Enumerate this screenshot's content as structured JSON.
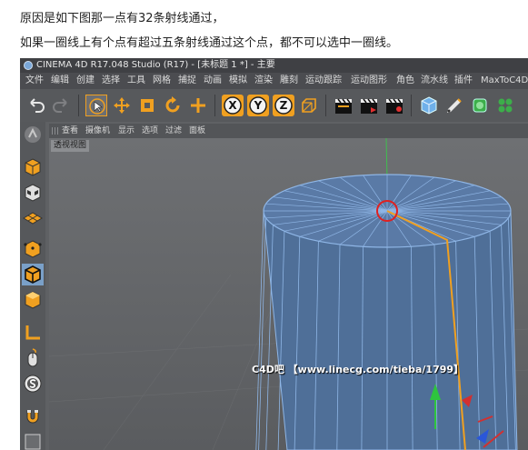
{
  "captions": {
    "line1": "原因是如下图那一点有32条射线通过，",
    "line2": "如果一圈线上有个点有超过五条射线通过这个点，都不可以选中一圈线。"
  },
  "window": {
    "title": "CINEMA 4D R17.048 Studio (R17) - [未标题 1 *] - 主要"
  },
  "menubar": {
    "items": [
      "文件",
      "编辑",
      "创建",
      "选择",
      "工具",
      "网格",
      "捕捉",
      "动画",
      "模拟",
      "渲染",
      "雕刻",
      "运动跟踪",
      "运动图形",
      "角色",
      "流水线",
      "插件",
      "MaxToC4D"
    ]
  },
  "toolbar": {
    "axis_x": "X",
    "axis_y": "Y",
    "axis_z": "Z"
  },
  "view_menu": {
    "items": [
      "查看",
      "摄像机",
      "显示",
      "选项",
      "过滤",
      "面板"
    ]
  },
  "viewport": {
    "label": "透视视图"
  },
  "watermark": "C4D吧 【www.linecg.com/tieba/1799】",
  "colors": {
    "selection_edge": "#f0a020",
    "highlight_circle": "#e02020",
    "wire": "#8fb6e6",
    "mesh_fill": "#4d6f9a"
  }
}
